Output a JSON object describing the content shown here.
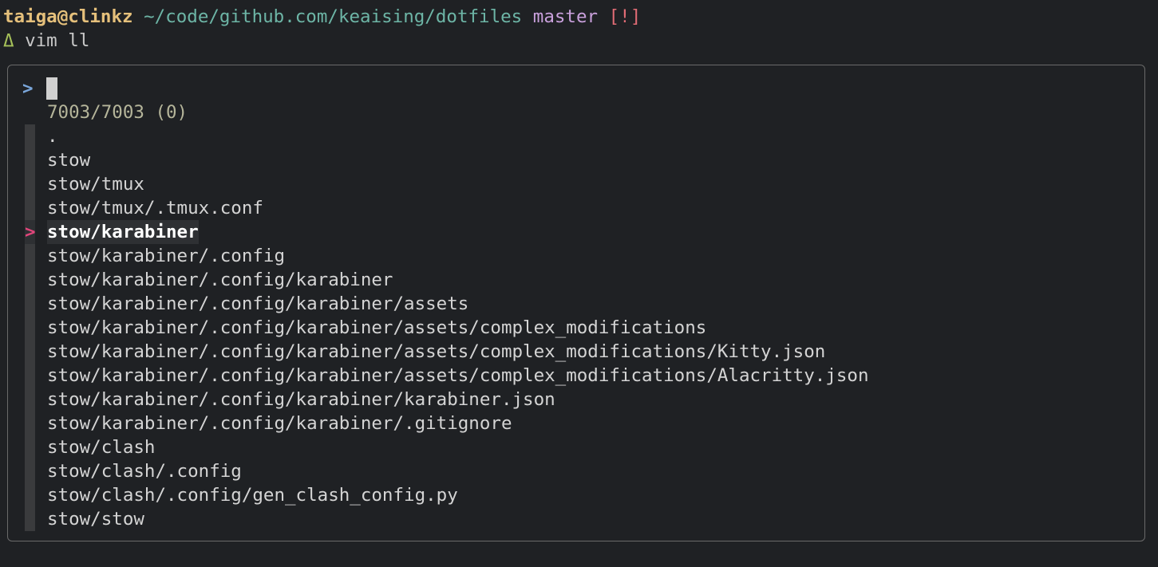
{
  "prompt": {
    "user_host": "taiga@clinkz",
    "cwd": "~/code/github.com/keaising/dotfiles",
    "branch": "master",
    "git_status": "[!]"
  },
  "command": {
    "symbol": "Δ",
    "text": "vim ll"
  },
  "finder": {
    "query_pointer": ">",
    "query": "",
    "match_count": "7003/7003 (0)",
    "selected_marker": ">",
    "selected_index": 4,
    "results": [
      ".",
      "stow",
      "stow/tmux",
      "stow/tmux/.tmux.conf",
      "stow/karabiner",
      "stow/karabiner/.config",
      "stow/karabiner/.config/karabiner",
      "stow/karabiner/.config/karabiner/assets",
      "stow/karabiner/.config/karabiner/assets/complex_modifications",
      "stow/karabiner/.config/karabiner/assets/complex_modifications/Kitty.json",
      "stow/karabiner/.config/karabiner/assets/complex_modifications/Alacritty.json",
      "stow/karabiner/.config/karabiner/karabiner.json",
      "stow/karabiner/.config/karabiner/.gitignore",
      "stow/clash",
      "stow/clash/.config",
      "stow/clash/.config/gen_clash_config.py",
      "stow/stow"
    ]
  },
  "colors": {
    "background": "#1f2124",
    "user_host": "#e5c07b",
    "cwd": "#6db5a6",
    "branch": "#c9a0dc",
    "git_status": "#e06c75",
    "prompt_symbol": "#a6c15a",
    "query_pointer": "#7aa6da",
    "selected_marker": "#e0457b",
    "match_count": "#b5b59a"
  }
}
